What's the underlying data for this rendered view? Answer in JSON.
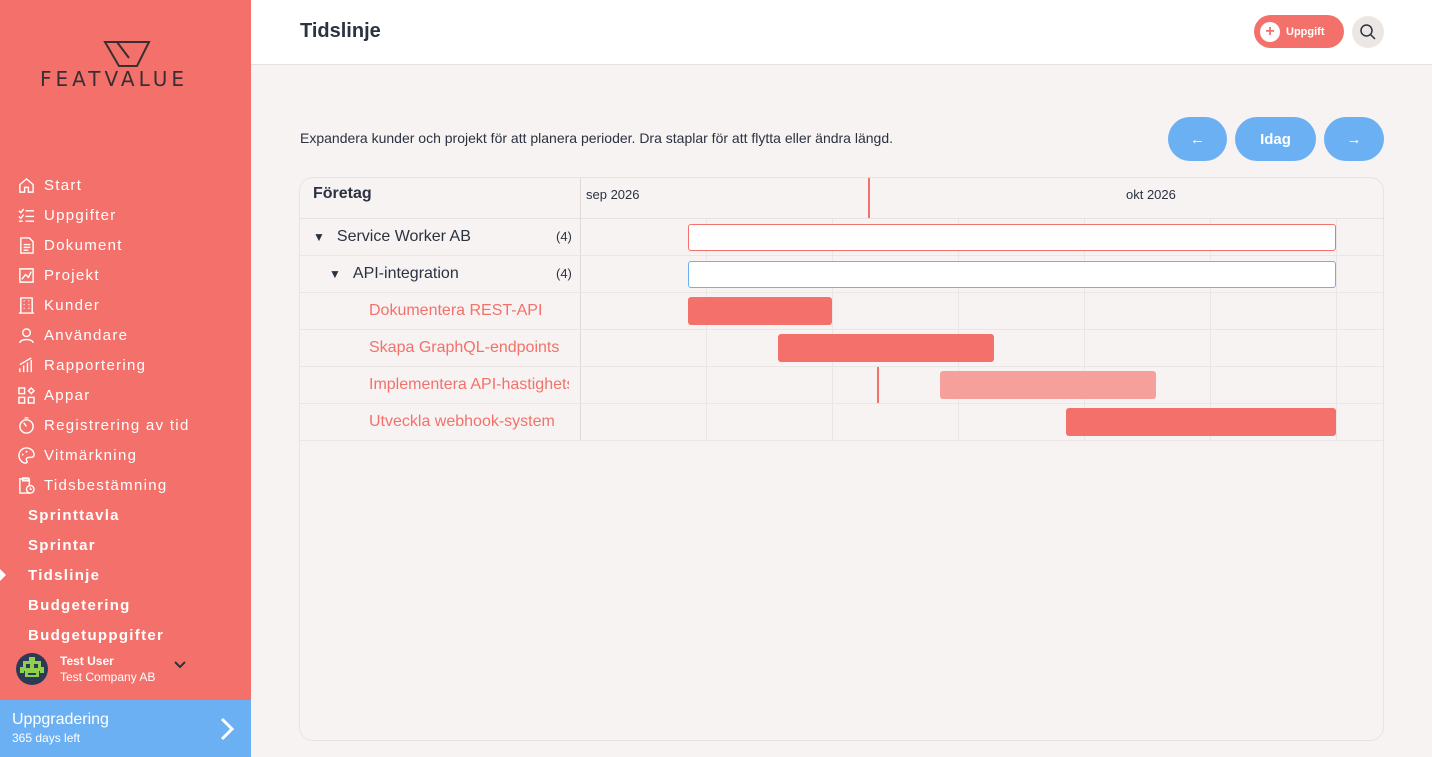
{
  "brand": {
    "name": "FEATVALUE",
    "accent": "#f3716a",
    "blue": "#6bb0f3"
  },
  "sidebar": {
    "items": [
      {
        "label": "Start",
        "icon": "home-icon"
      },
      {
        "label": "Uppgifter",
        "icon": "checklist-icon"
      },
      {
        "label": "Dokument",
        "icon": "document-icon"
      },
      {
        "label": "Projekt",
        "icon": "chart-icon"
      },
      {
        "label": "Kunder",
        "icon": "building-icon"
      },
      {
        "label": "Användare",
        "icon": "user-icon"
      },
      {
        "label": "Rapportering",
        "icon": "bar-chart-icon"
      },
      {
        "label": "Appar",
        "icon": "apps-icon"
      },
      {
        "label": "Registrering av tid",
        "icon": "stopwatch-icon"
      },
      {
        "label": "Vitmärkning",
        "icon": "palette-icon"
      },
      {
        "label": "Tidsbestämning",
        "icon": "clipboard-clock-icon"
      }
    ],
    "subitems": [
      {
        "label": "Sprinttavla",
        "active": false
      },
      {
        "label": "Sprintar",
        "active": false
      },
      {
        "label": "Tidslinje",
        "active": true
      },
      {
        "label": "Budgetering",
        "active": false
      },
      {
        "label": "Budgetuppgifter",
        "active": false
      }
    ],
    "user": {
      "name": "Test User",
      "company": "Test Company AB"
    },
    "upgrade": {
      "title": "Uppgradering",
      "subtitle": "365 days left"
    }
  },
  "header": {
    "title": "Tidslinje",
    "add_task_label": "Uppgift"
  },
  "toolbar": {
    "intro": "Expandera kunder och projekt för att planera perioder. Dra staplar för att flytta eller ändra längd.",
    "prev_label": "←",
    "today_label": "Idag",
    "next_label": "→"
  },
  "gantt": {
    "column_header": "Företag",
    "months": [
      "sep 2026",
      "okt 2026"
    ],
    "rows": [
      {
        "label": "Service Worker AB",
        "count": "(4)",
        "level": 0
      },
      {
        "label": "API-integration",
        "count": "(4)",
        "level": 1
      },
      {
        "label": "Dokumentera REST-API",
        "level": 2
      },
      {
        "label": "Skapa GraphQL-endpoints",
        "level": 2
      },
      {
        "label": "Implementera API-hastighetsbegränsning",
        "level": 2
      },
      {
        "label": "Utveckla webhook-system",
        "level": 2
      }
    ]
  }
}
